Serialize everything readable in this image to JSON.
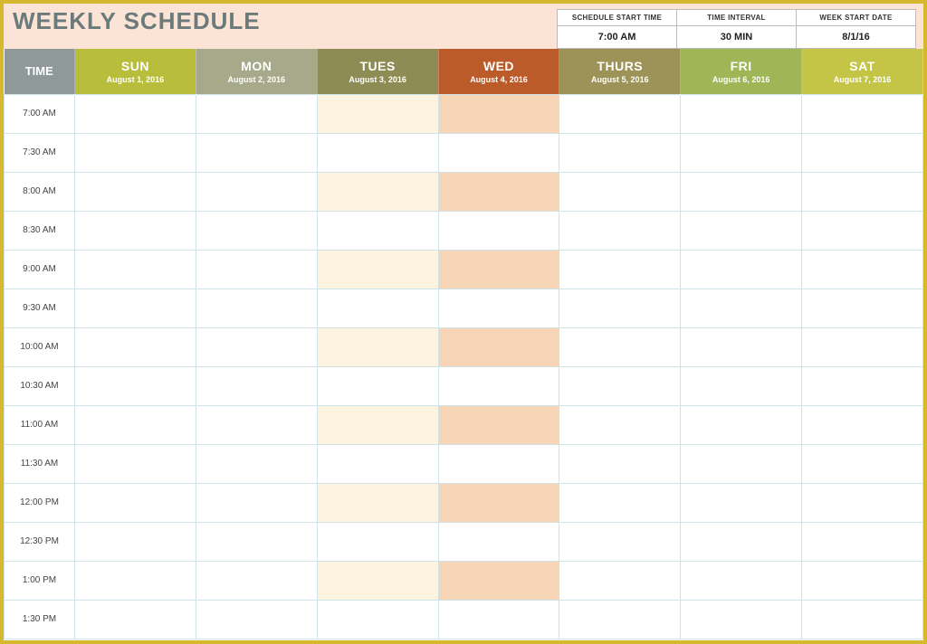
{
  "title": "WEEKLY SCHEDULE",
  "config": [
    {
      "label": "SCHEDULE START TIME",
      "value": "7:00 AM"
    },
    {
      "label": "TIME INTERVAL",
      "value": "30 MIN"
    },
    {
      "label": "WEEK START DATE",
      "value": "8/1/16"
    }
  ],
  "columns": {
    "time": "TIME",
    "days": [
      {
        "name": "SUN",
        "date": "August 1, 2016"
      },
      {
        "name": "MON",
        "date": "August 2, 2016"
      },
      {
        "name": "TUES",
        "date": "August 3, 2016"
      },
      {
        "name": "WED",
        "date": "August 4, 2016"
      },
      {
        "name": "THURS",
        "date": "August 5, 2016"
      },
      {
        "name": "FRI",
        "date": "August 6, 2016"
      },
      {
        "name": "SAT",
        "date": "August 7, 2016"
      }
    ]
  },
  "times": [
    "7:00 AM",
    "7:30 AM",
    "8:00 AM",
    "8:30 AM",
    "9:00 AM",
    "9:30 AM",
    "10:00 AM",
    "10:30 AM",
    "11:00 AM",
    "11:30 AM",
    "12:00 PM",
    "12:30 PM",
    "1:00 PM",
    "1:30 PM"
  ]
}
